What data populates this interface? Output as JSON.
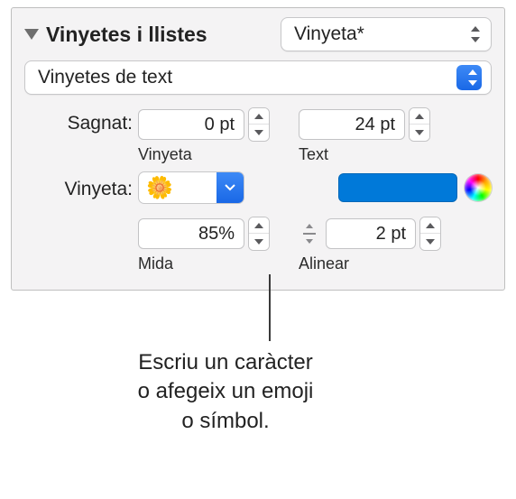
{
  "section_title": "Vinyetes i llistes",
  "style_popup": "Vinyeta*",
  "type_popup": "Vinyetes de text",
  "indent": {
    "label": "Sagnat:",
    "bullet_value": "0 pt",
    "bullet_sub": "Vinyeta",
    "text_value": "24 pt",
    "text_sub": "Text"
  },
  "bullet": {
    "label": "Vinyeta:",
    "icon": "🌼",
    "color": "#0079d9"
  },
  "size": {
    "value": "85%",
    "sub": "Mida"
  },
  "align": {
    "value": "2 pt",
    "sub": "Alinear"
  },
  "callout": {
    "line1": "Escriu un caràcter",
    "line2": "o afegeix un emoji",
    "line3": "o símbol."
  }
}
